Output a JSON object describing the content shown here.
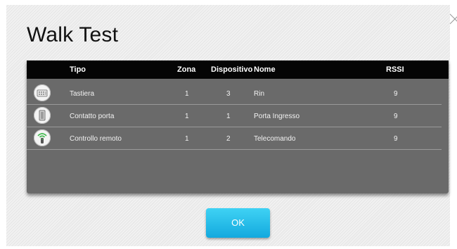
{
  "dialog": {
    "title": "Walk Test",
    "ok_label": "OK"
  },
  "table": {
    "headers": {
      "tipo": "Tipo",
      "zona": "Zona",
      "dispositivo": "Dispositivo",
      "nome": "Nome",
      "rssi": "RSSI"
    },
    "rows": [
      {
        "icon": "keypad-icon",
        "tipo": "Tastiera",
        "zona": "1",
        "dispositivo": "3",
        "nome": "Rin",
        "rssi": "9"
      },
      {
        "icon": "door-contact-icon",
        "tipo": "Contatto porta",
        "zona": "1",
        "dispositivo": "1",
        "nome": "Porta Ingresso",
        "rssi": "9"
      },
      {
        "icon": "remote-control-icon",
        "tipo": "Controllo remoto",
        "zona": "1",
        "dispositivo": "2",
        "nome": "Telecomando",
        "rssi": "9"
      }
    ]
  },
  "colors": {
    "header_bg": "#050505",
    "panel_bg": "#6a6a6a",
    "ok_button": "#1fb9e8",
    "remote_icon_accent": "#3db84a"
  }
}
